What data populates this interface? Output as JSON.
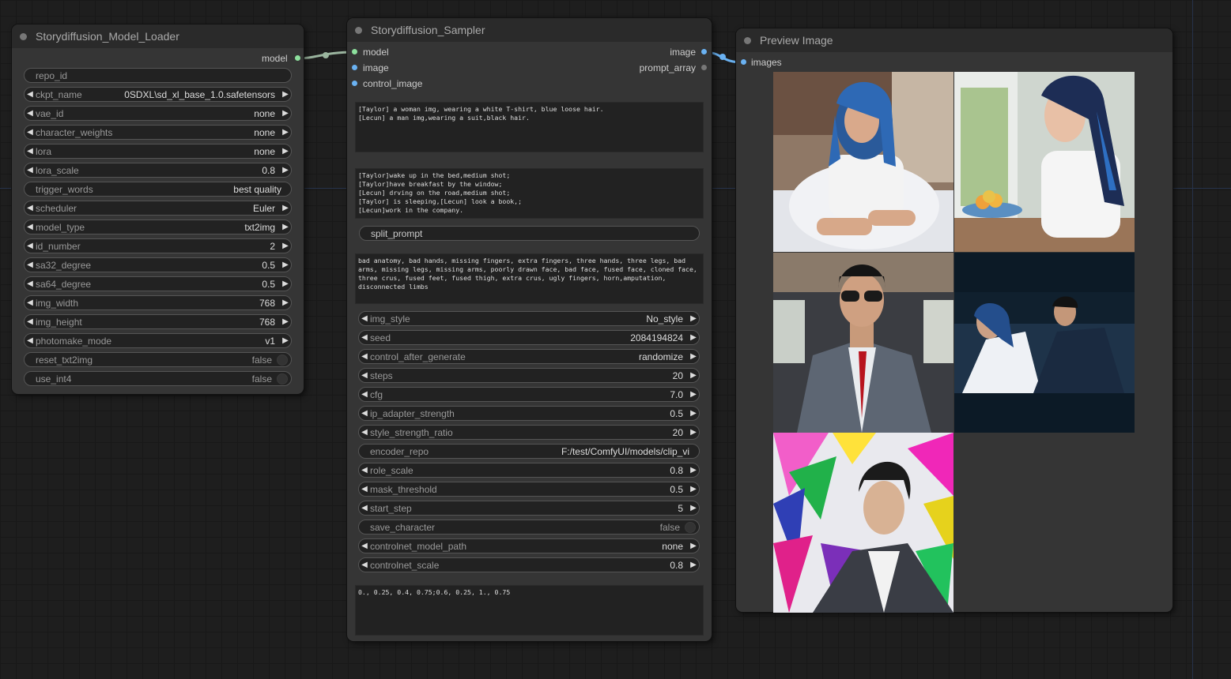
{
  "loader": {
    "title": "Storydiffusion_Model_Loader",
    "output_model": "model",
    "widgets": [
      {
        "label": "repo_id",
        "value": ""
      },
      {
        "label": "ckpt_name",
        "value": "0SDXL\\sd_xl_base_1.0.safetensors"
      },
      {
        "label": "vae_id",
        "value": "none"
      },
      {
        "label": "character_weights",
        "value": "none"
      },
      {
        "label": "lora",
        "value": "none"
      },
      {
        "label": "lora_scale",
        "value": "0.8"
      },
      {
        "label": "trigger_words",
        "value": "best quality"
      },
      {
        "label": "scheduler",
        "value": "Euler"
      },
      {
        "label": "model_type",
        "value": "txt2img"
      },
      {
        "label": "id_number",
        "value": "2"
      },
      {
        "label": "sa32_degree",
        "value": "0.5"
      },
      {
        "label": "sa64_degree",
        "value": "0.5"
      },
      {
        "label": "img_width",
        "value": "768"
      },
      {
        "label": "img_height",
        "value": "768"
      },
      {
        "label": "photomake_mode",
        "value": "v1"
      },
      {
        "label": "reset_txt2img",
        "value": "false"
      },
      {
        "label": "use_int4",
        "value": "false"
      }
    ]
  },
  "sampler": {
    "title": "Storydiffusion_Sampler",
    "inputs": [
      "model",
      "image",
      "control_image"
    ],
    "outputs": [
      "image",
      "prompt_array"
    ],
    "character_prompt": "[Taylor] a woman img, wearing a white T-shirt, blue loose hair.\n[Lecun] a man img,wearing a suit,black hair.",
    "scene_prompt": "[Taylor]wake up in the bed,medium shot;\n[Taylor]have breakfast by the window;\n[Lecun] drving on the road,medium shot;\n[Taylor] is sleeping,[Lecun] look a book,;\n[Lecun]work in the company.",
    "split_button": "split_prompt",
    "negative_prompt": "bad anatomy, bad hands, missing fingers, extra fingers, three hands, three legs, bad arms, missing legs, missing arms, poorly drawn face, bad face, fused face, cloned face, three crus, fused feet, fused thigh, extra crus, ugly fingers, horn,amputation, disconnected limbs",
    "widgets": [
      {
        "label": "img_style",
        "value": "No_style"
      },
      {
        "label": "seed",
        "value": "2084194824"
      },
      {
        "label": "control_after_generate",
        "value": "randomize"
      },
      {
        "label": "steps",
        "value": "20"
      },
      {
        "label": "cfg",
        "value": "7.0"
      },
      {
        "label": "ip_adapter_strength",
        "value": "0.5"
      },
      {
        "label": "style_strength_ratio",
        "value": "20"
      },
      {
        "label": "encoder_repo",
        "value": "F:/test/ComfyUI/models/clip_vi"
      },
      {
        "label": "role_scale",
        "value": "0.8"
      },
      {
        "label": "mask_threshold",
        "value": "0.5"
      },
      {
        "label": "start_step",
        "value": "5"
      },
      {
        "label": "save_character",
        "value": "false"
      },
      {
        "label": "controlnet_model_path",
        "value": "none"
      },
      {
        "label": "controlnet_scale",
        "value": "0.8"
      }
    ],
    "bottom_text": "0., 0.25, 0.4, 0.75;0.6, 0.25, 1., 0.75"
  },
  "preview": {
    "title": "Preview Image",
    "input": "images"
  },
  "colors": {
    "model_slot": "#8de09d",
    "image_slot": "#6ab2f2",
    "link_model": "#9bb59f",
    "link_image": "#6ab2f2"
  }
}
